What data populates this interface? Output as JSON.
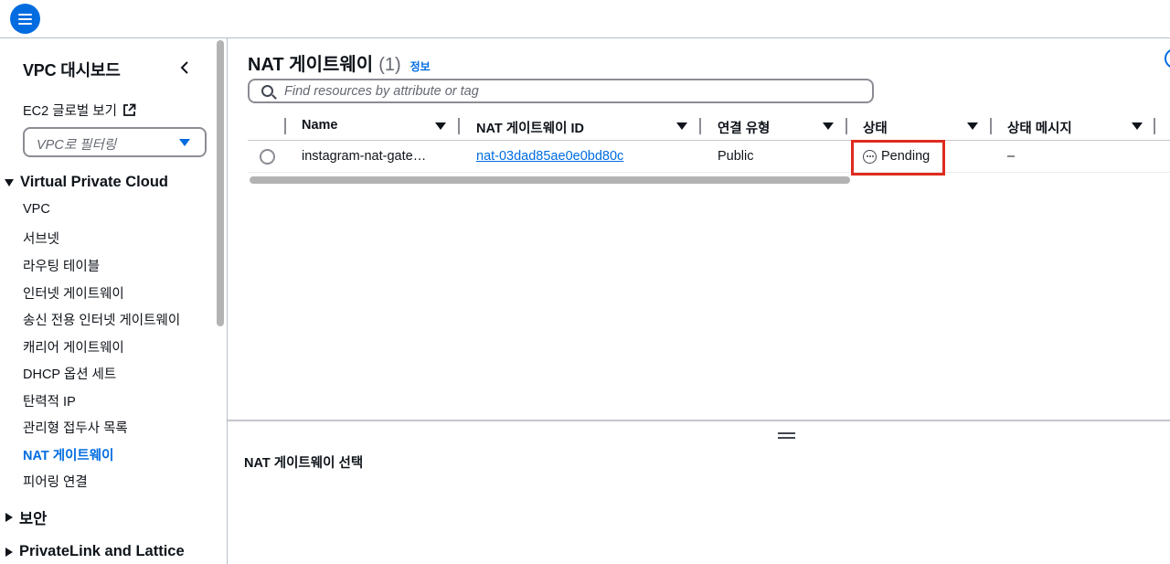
{
  "sidebar": {
    "title": "VPC 대시보드",
    "ec2_link": "EC2 글로벌 보기",
    "filter_placeholder": "VPC로 필터링",
    "section_vpc": "Virtual Private Cloud",
    "items": [
      {
        "label": "VPC"
      },
      {
        "label": "서브넷"
      },
      {
        "label": "라우팅 테이블"
      },
      {
        "label": "인터넷 게이트웨이"
      },
      {
        "label": "송신 전용 인터넷 게이트웨이"
      },
      {
        "label": "캐리어 게이트웨이"
      },
      {
        "label": "DHCP 옵션 세트"
      },
      {
        "label": "탄력적 IP"
      },
      {
        "label": "관리형 접두사 목록"
      },
      {
        "label": "NAT 게이트웨이",
        "active": true
      },
      {
        "label": "피어링 연결"
      }
    ],
    "section_security": "보안",
    "section_privatelink": "PrivateLink and Lattice"
  },
  "main": {
    "title": "NAT 게이트웨이",
    "count": "(1)",
    "info": "정보",
    "search_placeholder": "Find resources by attribute or tag",
    "columns": [
      "Name",
      "NAT 게이트웨이 ID",
      "연결 유형",
      "상태",
      "상태 메시지"
    ],
    "rows": [
      {
        "name": "instagram-nat-gate…",
        "id": "nat-03dad85ae0e0bd80c",
        "type": "Public",
        "status": "Pending",
        "status_message": "–"
      }
    ],
    "detail_title": "NAT 게이트웨이 선택"
  },
  "icons": {
    "menu": "hamburger-menu-icon",
    "collapse": "chevron-left-icon",
    "external": "external-link-icon",
    "search": "search-icon",
    "pending": "pending-icon"
  },
  "colors": {
    "accent": "#006ce0",
    "highlight": "#e02a1f"
  }
}
